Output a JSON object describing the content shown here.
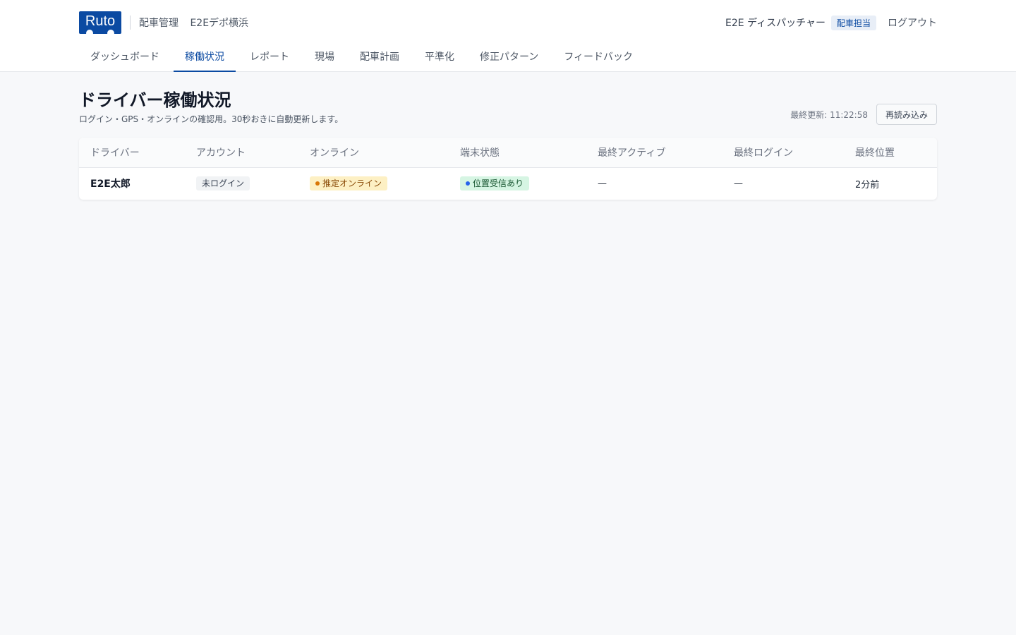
{
  "app": {
    "logo_text": "Ruto",
    "section": "配車管理",
    "depot": "E2Eデポ横浜"
  },
  "user": {
    "name": "E2E ディスパッチャー",
    "role": "配車担当",
    "logout_label": "ログアウト"
  },
  "nav": {
    "items": [
      {
        "label": "ダッシュボード"
      },
      {
        "label": "稼働状況"
      },
      {
        "label": "レポート"
      },
      {
        "label": "現場"
      },
      {
        "label": "配車計画"
      },
      {
        "label": "平準化"
      },
      {
        "label": "修正パターン"
      },
      {
        "label": "フィードバック"
      }
    ],
    "active_index": 1
  },
  "page": {
    "title": "ドライバー稼働状況",
    "subtitle": "ログイン・GPS・オンラインの確認用。30秒おきに自動更新します。",
    "last_updated": "最終更新: 11:22:58",
    "reload_label": "再読み込み"
  },
  "table": {
    "columns": [
      "ドライバー",
      "アカウント",
      "オンライン",
      "端末状態",
      "最終アクティブ",
      "最終ログイン",
      "最終位置"
    ],
    "rows": [
      {
        "driver": "E2E太郎",
        "account": "未ログイン",
        "online": "推定オンライン",
        "device": "位置受信あり",
        "last_active": "—",
        "last_login": "—",
        "last_location": "2分前"
      }
    ]
  },
  "colors": {
    "brand": "#0b4aa2",
    "online_dot": "#d97706",
    "device_dot": "#2563eb"
  }
}
